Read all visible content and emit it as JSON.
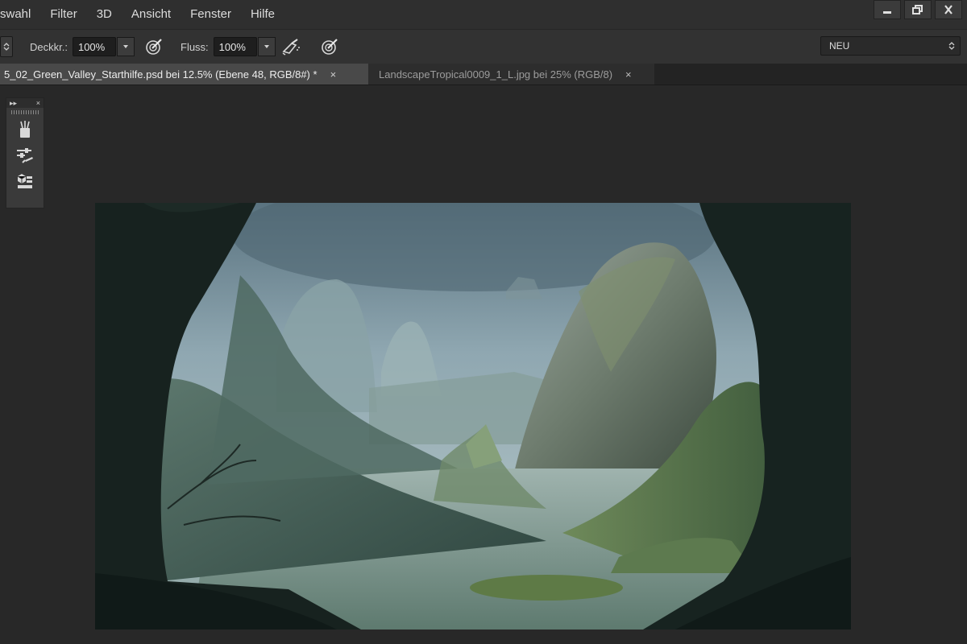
{
  "menu": {
    "items": [
      "swahl",
      "Filter",
      "3D",
      "Ansicht",
      "Fenster",
      "Hilfe"
    ]
  },
  "window": {
    "minimize_icon": "minimize-icon",
    "restore_icon": "restore-icon",
    "close_icon": "close-icon"
  },
  "options": {
    "opacity_label": "Deckkr.:",
    "opacity_value": "100%",
    "flow_label": "Fluss:",
    "flow_value": "100%",
    "preset_value": "NEU"
  },
  "tabs": [
    {
      "label": "5_02_Green_Valley_Starthilfe.psd bei 12.5% (Ebene 48, RGB/8#) *",
      "active": true
    },
    {
      "label": "LandscapeTropical0009_1_L.jpg bei 25% (RGB/8)",
      "active": false
    }
  ],
  "tab_close_glyph": "×",
  "panel": {
    "collapse_glyph": "▸▸",
    "close_glyph": "×",
    "icons": [
      "brush-presets-icon",
      "brush-settings-icon",
      "clone-source-icon"
    ]
  },
  "colors": {
    "menubar": "#2f2f2f",
    "optionsbar": "#323232",
    "workspace": "#282828",
    "active_tab": "#494949",
    "inactive_tab": "#2d2d2d"
  }
}
